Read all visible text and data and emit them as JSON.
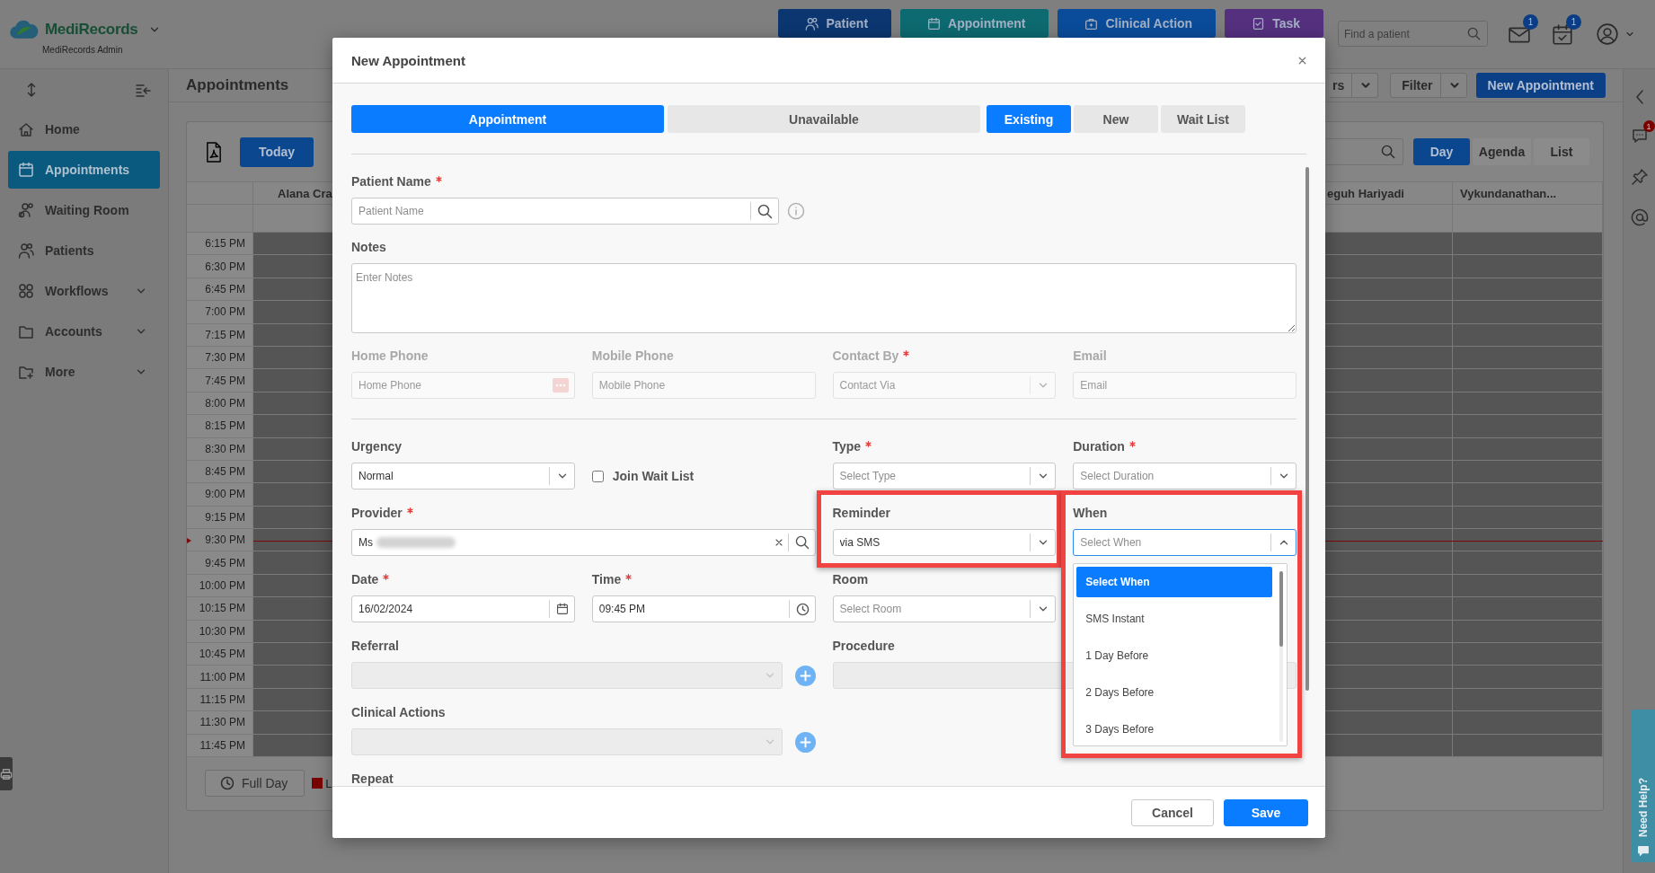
{
  "header": {
    "logo": "MediRecords",
    "subtitle": "MediRecords Admin",
    "actions": [
      {
        "label": "Patient",
        "color": "#0b3670"
      },
      {
        "label": "Appointment",
        "color": "#0d6a70"
      },
      {
        "label": "Clinical Action",
        "color": "#0a4c9a"
      },
      {
        "label": "Task",
        "color": "#55307f"
      }
    ],
    "search": {
      "placeholder": "Find a patient"
    },
    "notifications": [
      {
        "kind": "mail",
        "count": "1"
      },
      {
        "kind": "tasks",
        "count": "1"
      }
    ]
  },
  "sidebar": {
    "items": [
      {
        "label": "Home",
        "selected": false,
        "has_submenu": false
      },
      {
        "label": "Appointments",
        "selected": true,
        "has_submenu": false
      },
      {
        "label": "Waiting Room",
        "selected": false,
        "has_submenu": false
      },
      {
        "label": "Patients",
        "selected": false,
        "has_submenu": false
      },
      {
        "label": "Workflows",
        "selected": false,
        "has_submenu": true
      },
      {
        "label": "Accounts",
        "selected": false,
        "has_submenu": true
      },
      {
        "label": "More",
        "selected": false,
        "has_submenu": true
      }
    ]
  },
  "page": {
    "title": "Appointments",
    "toolbar": [
      {
        "label": "rs",
        "kind": "split"
      },
      {
        "label": "Filter",
        "kind": "split"
      },
      {
        "label": "New Appointment",
        "kind": "primary"
      }
    ]
  },
  "calendar": {
    "today": "Today",
    "views": [
      {
        "label": "Day",
        "selected": true
      },
      {
        "label": "Agenda",
        "selected": false
      },
      {
        "label": "List",
        "selected": false
      }
    ],
    "columns": [
      "Alana Cra",
      "eguh Hariyadi",
      "Vykundanathan..."
    ],
    "times": [
      {
        "label": "6:15 PM",
        "now": false
      },
      {
        "label": "6:30 PM",
        "now": false
      },
      {
        "label": "6:45 PM",
        "now": false
      },
      {
        "label": "7:00 PM",
        "now": false
      },
      {
        "label": "7:15 PM",
        "now": false
      },
      {
        "label": "7:30 PM",
        "now": false
      },
      {
        "label": "7:45 PM",
        "now": false
      },
      {
        "label": "8:00 PM",
        "now": false
      },
      {
        "label": "8:15 PM",
        "now": false
      },
      {
        "label": "8:30 PM",
        "now": false
      },
      {
        "label": "8:45 PM",
        "now": false
      },
      {
        "label": "9:00 PM",
        "now": false
      },
      {
        "label": "9:15 PM",
        "now": false
      },
      {
        "label": "9:30 PM",
        "now": true
      },
      {
        "label": "9:45 PM",
        "now": false
      },
      {
        "label": "10:00 PM",
        "now": false
      },
      {
        "label": "10:15 PM",
        "now": false
      },
      {
        "label": "10:30 PM",
        "now": false
      },
      {
        "label": "10:45 PM",
        "now": false
      },
      {
        "label": "11:00 PM",
        "now": false
      },
      {
        "label": "11:15 PM",
        "now": false
      },
      {
        "label": "11:30 PM",
        "now": false
      },
      {
        "label": "11:45 PM",
        "now": false
      }
    ],
    "full_day": "Full Day",
    "legend": [
      {
        "label": "L",
        "color": "#7a0000"
      }
    ]
  },
  "right_rail": {
    "chat_count": "1",
    "help": "Need Help?"
  },
  "modal": {
    "title": "New Appointment",
    "mode_tabs": [
      {
        "label": "Appointment",
        "selected": true
      },
      {
        "label": "Unavailable",
        "selected": false
      }
    ],
    "patient_tabs": [
      {
        "label": "Existing",
        "selected": true
      },
      {
        "label": "New",
        "selected": false
      },
      {
        "label": "Wait List",
        "selected": false
      }
    ],
    "sections": [
      {
        "rows": [
          [
            {
              "kind": "patient-search",
              "label": "Patient Name",
              "required": true,
              "placeholder": "Patient Name",
              "disabled": false,
              "readonly": false,
              "highlighted": false
            }
          ],
          [
            {
              "kind": "textarea",
              "label": "Notes",
              "required": false,
              "placeholder": "Enter Notes",
              "disabled": false,
              "readonly": false,
              "highlighted": false
            }
          ],
          [
            {
              "kind": "phone",
              "label": "Home Phone",
              "required": false,
              "placeholder": "Home Phone",
              "disabled": false,
              "readonly": true,
              "highlighted": false
            },
            {
              "kind": "text",
              "label": "Mobile Phone",
              "required": false,
              "placeholder": "Mobile Phone",
              "disabled": false,
              "readonly": true,
              "highlighted": false
            },
            {
              "kind": "select",
              "label": "Contact By",
              "required": true,
              "placeholder": "Contact Via",
              "disabled": false,
              "readonly": true,
              "highlighted": false,
              "expanded": false
            },
            {
              "kind": "text",
              "label": "Email",
              "required": false,
              "placeholder": "Email",
              "disabled": false,
              "readonly": true,
              "highlighted": false
            }
          ]
        ]
      },
      {
        "rows": [
          [
            {
              "kind": "select",
              "label": "Urgency",
              "required": false,
              "value": "Normal",
              "disabled": false,
              "readonly": false,
              "highlighted": false,
              "expanded": false
            },
            {
              "kind": "checkbox",
              "label": "Join Wait List",
              "checked": false
            },
            {
              "kind": "select",
              "label": "Type",
              "required": true,
              "placeholder": "Select Type",
              "disabled": false,
              "readonly": false,
              "highlighted": false,
              "expanded": false
            },
            {
              "kind": "select",
              "label": "Duration",
              "required": true,
              "placeholder": "Select Duration",
              "disabled": false,
              "readonly": false,
              "highlighted": false,
              "expanded": false
            }
          ],
          [
            {
              "kind": "provider-search",
              "label": "Provider",
              "required": true,
              "value": "Ms",
              "redacted": true,
              "disabled": false,
              "readonly": false,
              "highlighted": false
            },
            "",
            {
              "kind": "select",
              "label": "Reminder",
              "required": false,
              "value": "via SMS",
              "disabled": false,
              "readonly": false,
              "highlighted": true,
              "expanded": false
            },
            {
              "kind": "select",
              "label": "When",
              "required": false,
              "placeholder": "Select When",
              "disabled": false,
              "readonly": false,
              "highlighted": true,
              "expanded": true,
              "options": [
                {
                  "label": "Select When",
                  "selected": true
                },
                {
                  "label": "SMS Instant",
                  "selected": false
                },
                {
                  "label": "1 Day Before",
                  "selected": false
                },
                {
                  "label": "2 Days Before",
                  "selected": false
                },
                {
                  "label": "3 Days Before",
                  "selected": false
                }
              ]
            }
          ],
          [
            {
              "kind": "date",
              "label": "Date",
              "required": true,
              "value": "16/02/2024",
              "disabled": false,
              "readonly": false,
              "highlighted": false
            },
            {
              "kind": "time",
              "label": "Time",
              "required": true,
              "value": "09:45 PM",
              "disabled": false,
              "readonly": false,
              "highlighted": false
            },
            {
              "kind": "select",
              "label": "Room",
              "required": false,
              "placeholder": "Select Room",
              "disabled": false,
              "readonly": false,
              "highlighted": false,
              "expanded": false
            }
          ],
          [
            {
              "kind": "add-select",
              "label": "Referral",
              "required": false,
              "disabled": true,
              "readonly": false,
              "highlighted": false
            },
            "",
            {
              "kind": "wide-select",
              "label": "Procedure",
              "required": false,
              "disabled": true,
              "readonly": false,
              "highlighted": false,
              "expanded": false
            }
          ],
          [
            {
              "kind": "add-select",
              "label": "Clinical Actions",
              "required": false,
              "disabled": true,
              "readonly": false,
              "highlighted": false
            }
          ],
          [
            {
              "kind": "label",
              "label": "Repeat",
              "required": false
            }
          ]
        ]
      }
    ],
    "buttons": [
      {
        "label": "Cancel",
        "kind": "secondary"
      },
      {
        "label": "Save",
        "kind": "primary"
      }
    ]
  }
}
